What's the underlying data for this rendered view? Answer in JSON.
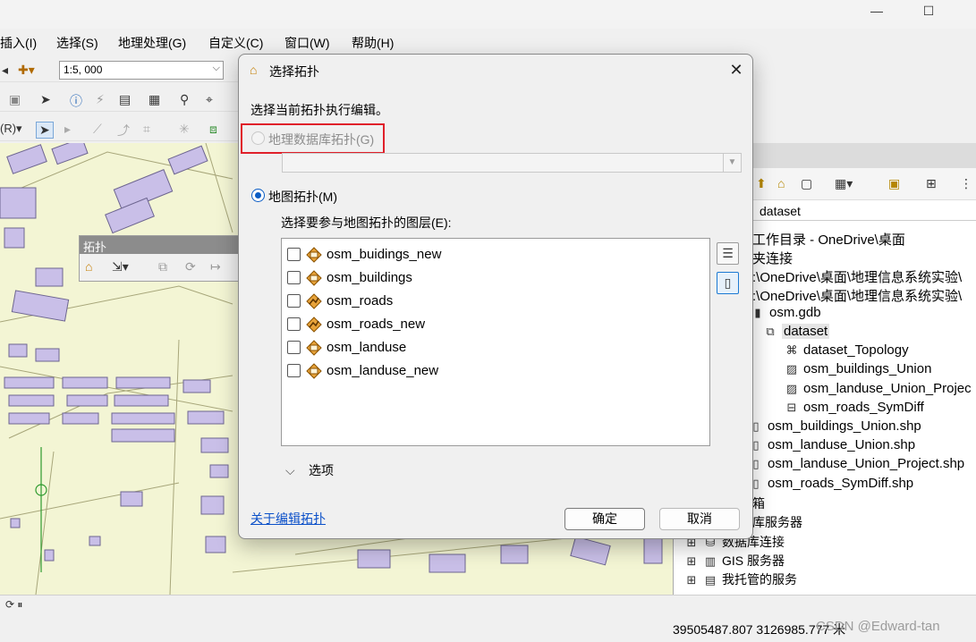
{
  "window": {
    "minimize_glyph": "—",
    "maximize_glyph": "☐"
  },
  "menubar": [
    "插入(I)",
    "选择(S)",
    "地理处理(G)",
    "自定义(C)",
    "窗口(W)",
    "帮助(H)"
  ],
  "toolbar": {
    "scale": "1:5, 000",
    "editor_label": "(R)"
  },
  "topology_toolbar": {
    "title": "拓扑"
  },
  "dialog": {
    "title": "选择拓扑",
    "prompt": "选择当前拓扑执行编辑。",
    "geodatabase_option": "地理数据库拓扑(G)",
    "map_option": "地图拓扑(M)",
    "layers_label": "选择要参与地图拓扑的图层(E):",
    "layers": [
      {
        "name": "osm_buidings_new",
        "icon": "polygon-layer-icon",
        "checked": false
      },
      {
        "name": "osm_buildings",
        "icon": "polygon-layer-icon",
        "checked": false
      },
      {
        "name": "osm_roads",
        "icon": "line-layer-icon",
        "checked": false
      },
      {
        "name": "osm_roads_new",
        "icon": "line-layer-icon",
        "checked": false
      },
      {
        "name": "osm_landuse",
        "icon": "polygon-layer-icon",
        "checked": false
      },
      {
        "name": "osm_landuse_new",
        "icon": "polygon-layer-icon",
        "checked": false
      }
    ],
    "options_label": "选项",
    "about_link": "关于编辑拓扑",
    "ok_label": "确定",
    "cancel_label": "取消",
    "selected_option": "map"
  },
  "catalog": {
    "location": "dataset",
    "tree": [
      {
        "label": "工作目录 - OneDrive\\桌面",
        "icon": ""
      },
      {
        "label": "夹连接",
        "icon": ""
      },
      {
        "label": ":\\OneDrive\\桌面\\地理信息系统实验\\",
        "icon": ""
      },
      {
        "label": ":\\OneDrive\\桌面\\地理信息系统实验\\",
        "icon": ""
      },
      {
        "label": "osm.gdb",
        "icon": "gdb-icon"
      },
      {
        "label": "dataset",
        "icon": "dataset-icon"
      },
      {
        "label": "dataset_Topology",
        "icon": "topology-icon"
      },
      {
        "label": "osm_buildings_Union",
        "icon": "polygon-fc-icon"
      },
      {
        "label": "osm_landuse_Union_Projec",
        "icon": "polygon-fc-icon"
      },
      {
        "label": "osm_roads_SymDiff",
        "icon": "line-fc-icon"
      },
      {
        "label": "osm_buildings_Union.shp",
        "icon": "shapefile-icon"
      },
      {
        "label": "osm_landuse_Union.shp",
        "icon": "shapefile-icon"
      },
      {
        "label": "osm_landuse_Union_Project.shp",
        "icon": "shapefile-icon"
      },
      {
        "label": "osm_roads_SymDiff.shp",
        "icon": "shapefile-icon"
      },
      {
        "label": "箱",
        "icon": ""
      },
      {
        "label": "库服务器",
        "icon": ""
      },
      {
        "label": "数据库连接",
        "icon": "database-icon"
      },
      {
        "label": "GIS 服务器",
        "icon": "server-icon"
      },
      {
        "label": "我托管的服务",
        "icon": "hosted-icon"
      }
    ]
  },
  "status": {
    "coordinates": "39505487.807  3126985.777 米",
    "watermark": "CSDN @Edward-tan"
  },
  "colors": {
    "accent": "#0a5cc4",
    "highlight": "#e0202a",
    "building_fill": "#c9bfe8",
    "map_bg": "#f3f5d4"
  }
}
